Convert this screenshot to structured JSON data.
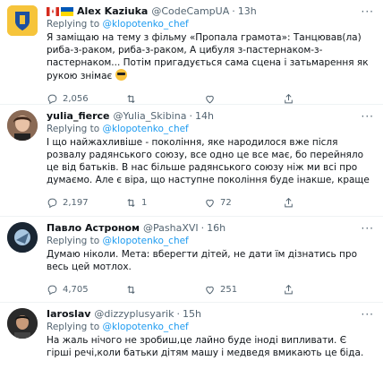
{
  "tweets": [
    {
      "name": "Alex Kaziuka",
      "handle": "@CodeCampUA",
      "time": "13h",
      "replying_prefix": "Replying to",
      "replying_to": "@klopotenko_chef",
      "text": "Я заміщаю на тему з фільму «Пропала грамота»: Танцював(ла) риба-з-раком, риба-з-раком, А цибуля з-пастернаком-з-пастернаком... Потім пригадується сама сцена і затьмарення як рукою знімає",
      "emoji": "smiling-face-with-sunglasses",
      "reply_count": "2,056",
      "retweet_count": "",
      "like_count": "",
      "avatar_colors": [
        "#f6c43b",
        "#1e50a0"
      ]
    },
    {
      "name": "yulia_fierce",
      "handle": "@Yulia_Skibina",
      "time": "14h",
      "replying_prefix": "Replying to",
      "replying_to": "@klopotenko_chef",
      "text": "І що найжахливіше - покоління, яке народилося вже після розвалу радянського союзу, все одно це все має, бо перейняло це від батьків. В нас більше радянського союзу ніж ми всі про думаємо. Але є віра, що наступне покоління буде інакше, краще",
      "reply_count": "2,197",
      "retweet_count": "1",
      "like_count": "72"
    },
    {
      "name": "Павло Астроном",
      "handle": "@PashaXVI",
      "time": "16h",
      "replying_prefix": "Replying to",
      "replying_to": "@klopotenko_chef",
      "text": "Думаю ніколи. Мета: вберегти дітей, не дати їм дізнатись про весь цей мотлох.",
      "reply_count": "4,705",
      "retweet_count": "",
      "like_count": "251"
    },
    {
      "name": "Iaroslav",
      "handle": "@dizzyplusyarik",
      "time": "15h",
      "replying_prefix": "Replying to",
      "replying_to": "@klopotenko_chef",
      "text": "На жаль нічого не зробиш,це лайно буде іноді випливати. Є гірші речі,коли батьки дітям машу і медведя вмикають це біда."
    }
  ],
  "more_glyph": "···"
}
